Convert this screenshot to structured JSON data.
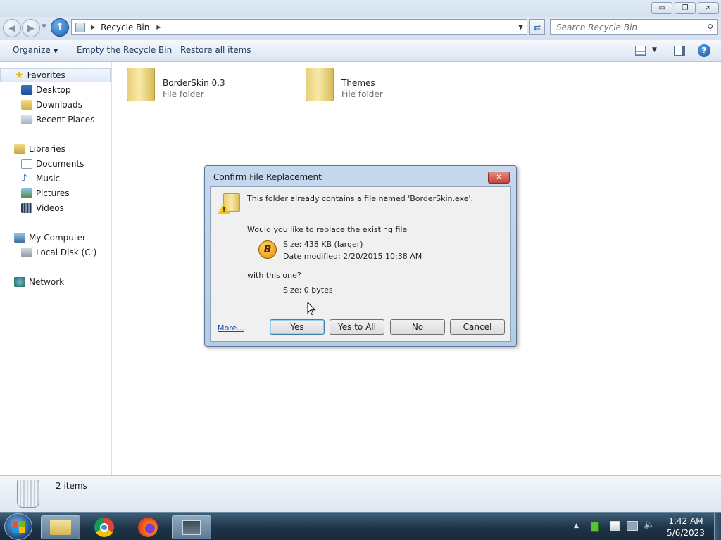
{
  "window": {
    "minimize_glyph": "▭",
    "restore_glyph": "❐",
    "close_glyph": "✕"
  },
  "address_bar": {
    "location": "Recycle Bin",
    "search_placeholder": "Search Recycle Bin"
  },
  "toolbar": {
    "organize_label": "Organize",
    "empty_label": "Empty the Recycle Bin",
    "restore_label": "Restore all items"
  },
  "nav_pane": {
    "favorites": {
      "label": "Favorites",
      "items": [
        "Desktop",
        "Downloads",
        "Recent Places"
      ]
    },
    "libraries": {
      "label": "Libraries",
      "items": [
        "Documents",
        "Music",
        "Pictures",
        "Videos"
      ]
    },
    "computer": {
      "label": "My Computer",
      "items": [
        "Local Disk (C:)"
      ]
    },
    "network": {
      "label": "Network"
    }
  },
  "files": [
    {
      "name": "BorderSkin 0.3",
      "type": "File folder"
    },
    {
      "name": "Themes",
      "type": "File folder"
    }
  ],
  "status": {
    "item_count": "2 items"
  },
  "dialog": {
    "title": "Confirm File Replacement",
    "message": "This folder already contains a file named 'BorderSkin.exe'.",
    "question": "Would you like to replace the existing file",
    "existing_size": "Size: 438 KB (larger)",
    "existing_date": "Date modified: 2/20/2015 10:38 AM",
    "with_text": "with this one?",
    "new_size": "Size: 0 bytes",
    "more_link": "More...",
    "buttons": {
      "yes": "Yes",
      "yes_all": "Yes to All",
      "no": "No",
      "cancel": "Cancel"
    }
  },
  "taskbar": {
    "time": "1:42 AM",
    "date": "5/6/2023"
  },
  "colors": {
    "accent": "#1e395b",
    "link": "#0b4fa8",
    "close_red": "#c9453b"
  }
}
